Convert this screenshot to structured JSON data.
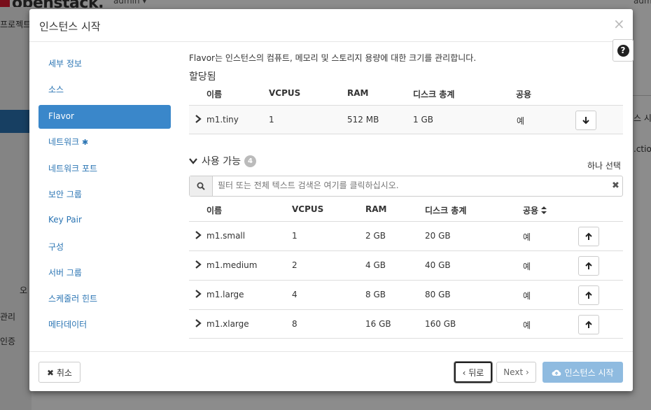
{
  "background": {
    "logo": "openstack.",
    "user_menu": "admin ▾",
    "user_menu_right": "admin",
    "sidebar_texts": [
      "프로젝트",
      "오",
      "관리",
      "인증"
    ],
    "right_texts": [
      "스 시작",
      ".ction"
    ]
  },
  "modal": {
    "title": "인스턴스 시작",
    "close_icon": "×",
    "help_icon": "?"
  },
  "nav": {
    "items": [
      {
        "label": "세부 정보"
      },
      {
        "label": "소스"
      },
      {
        "label": "Flavor",
        "active": true
      },
      {
        "label": "네트워크",
        "required": "✱"
      },
      {
        "label": "네트워크 포트"
      },
      {
        "label": "보안 그룹"
      },
      {
        "label": "Key Pair"
      },
      {
        "label": "구성"
      },
      {
        "label": "서버 그룹"
      },
      {
        "label": "스케줄러 힌트"
      },
      {
        "label": "메타데이터"
      }
    ]
  },
  "flavor": {
    "intro": "Flavor는 인스턴스의 컴퓨트, 메모리 및 스토리지 용량에 대한 크기를 관리합니다.",
    "allocated_title": "할당됨",
    "columns": [
      "이름",
      "VCPUS",
      "RAM",
      "디스크 총계",
      "공용"
    ],
    "allocated": [
      {
        "name": "m1.tiny",
        "vcpus": "1",
        "ram": "512 MB",
        "disk": "1 GB",
        "public": "예"
      }
    ],
    "available_title": "사용 가능",
    "available_count": "4",
    "select_one": "하나 선택",
    "search_placeholder": "필터 또는 전체 텍스트 검색은 여기를 클릭하십시오.",
    "public_sort_icon": "sort-icon",
    "available": [
      {
        "name": "m1.small",
        "vcpus": "1",
        "ram": "2 GB",
        "disk": "20 GB",
        "public": "예"
      },
      {
        "name": "m1.medium",
        "vcpus": "2",
        "ram": "4 GB",
        "disk": "40 GB",
        "public": "예"
      },
      {
        "name": "m1.large",
        "vcpus": "4",
        "ram": "8 GB",
        "disk": "80 GB",
        "public": "예"
      },
      {
        "name": "m1.xlarge",
        "vcpus": "8",
        "ram": "16 GB",
        "disk": "160 GB",
        "public": "예"
      }
    ]
  },
  "footer": {
    "cancel": "✖ 취소",
    "back": "‹ 뒤로",
    "next": "Next ›",
    "launch": "인스턴스 시작"
  },
  "colors": {
    "accent": "#3a87ca",
    "link": "#2a74b3",
    "primary_disabled": "#8fbbe0"
  }
}
